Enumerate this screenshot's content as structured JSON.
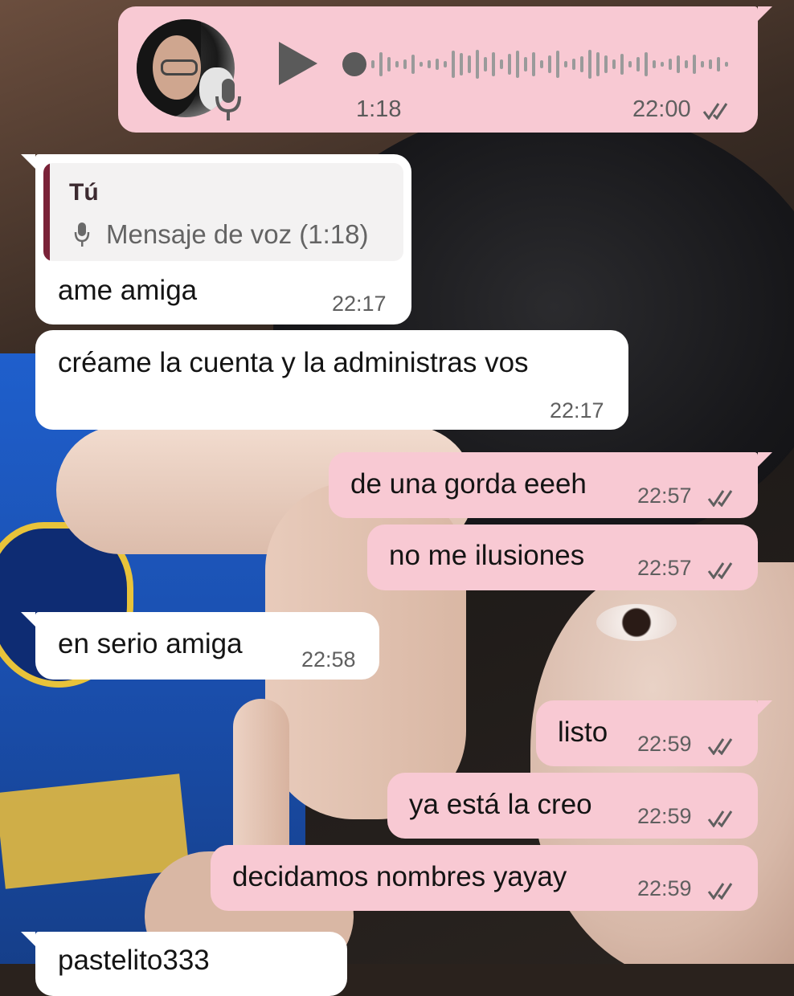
{
  "voice_message": {
    "duration": "1:18",
    "time": "22:00",
    "status": "read",
    "progress": 0.0,
    "icons": {
      "play": "play-icon",
      "mic": "mic-icon",
      "ticks": "double-check-icon"
    }
  },
  "messages": [
    {
      "direction": "incoming",
      "quoted": {
        "author": "Tú",
        "text": "Mensaje de voz (1:18)",
        "icon": "mic-icon"
      },
      "text": "ame amiga",
      "time": "22:17"
    },
    {
      "direction": "incoming",
      "text": "créame la cuenta y la administras vos",
      "time": "22:17"
    },
    {
      "direction": "outgoing",
      "text": "de una gorda eeeh",
      "time": "22:57",
      "status": "read"
    },
    {
      "direction": "outgoing",
      "text": "no me ilusiones",
      "time": "22:57",
      "status": "read"
    },
    {
      "direction": "incoming",
      "text": "en serio amiga",
      "time": "22:58"
    },
    {
      "direction": "outgoing",
      "text": "listo",
      "time": "22:59",
      "status": "read"
    },
    {
      "direction": "outgoing",
      "text": "ya está la creo",
      "time": "22:59",
      "status": "read"
    },
    {
      "direction": "outgoing",
      "text": "decidamos nombres yayay",
      "time": "22:59",
      "status": "read"
    },
    {
      "direction": "incoming",
      "text": "pastelito333",
      "time": ""
    }
  ],
  "colors": {
    "outgoing_bubble": "#f8c9d3",
    "incoming_bubble": "#ffffff",
    "quote_bar": "#7a2238",
    "text": "#141414",
    "meta": "#5f5f5f"
  }
}
